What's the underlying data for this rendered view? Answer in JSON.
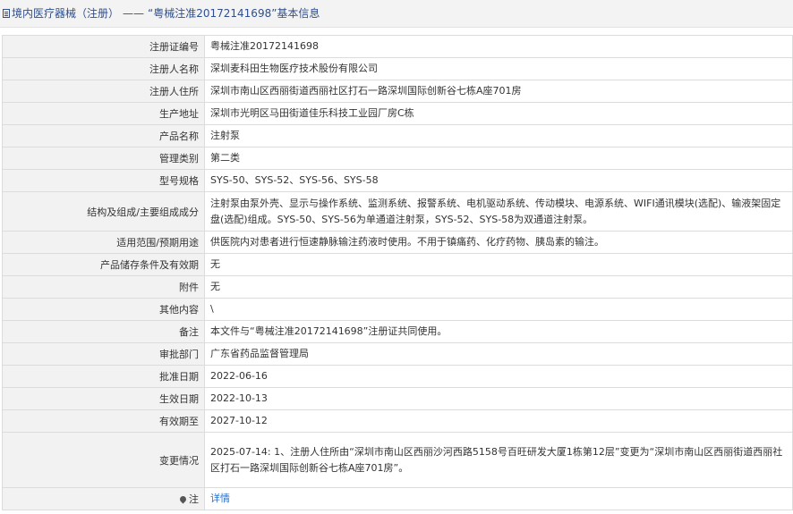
{
  "header": {
    "category": "境内医疗器械（注册）",
    "separator": "——",
    "title": "“粤械注准20172141698”基本信息"
  },
  "rows": [
    {
      "label": "注册证编号",
      "value": "粤械注准20172141698"
    },
    {
      "label": "注册人名称",
      "value": "深圳麦科田生物医疗技术股份有限公司"
    },
    {
      "label": "注册人住所",
      "value": "深圳市南山区西丽街道西丽社区打石一路深圳国际创新谷七栋A座701房"
    },
    {
      "label": "生产地址",
      "value": "深圳市光明区马田街道佳乐科技工业园厂房C栋"
    },
    {
      "label": "产品名称",
      "value": "注射泵"
    },
    {
      "label": "管理类别",
      "value": "第二类"
    },
    {
      "label": "型号规格",
      "value": "SYS-50、SYS-52、SYS-56、SYS-58"
    },
    {
      "label": "结构及组成/主要组成成分",
      "value": "注射泵由泵外壳、显示与操作系统、监测系统、报警系统、电机驱动系统、传动模块、电源系统、WIFI通讯模块(选配)、输液架固定盘(选配)组成。SYS-50、SYS-56为单通道注射泵，SYS-52、SYS-58为双通道注射泵。"
    },
    {
      "label": "适用范围/预期用途",
      "value": "供医院内对患者进行恒速静脉输注药液时使用。不用于镇痛药、化疗药物、胰岛素的输注。"
    },
    {
      "label": "产品储存条件及有效期",
      "value": "无"
    },
    {
      "label": "附件",
      "value": "无"
    },
    {
      "label": "其他内容",
      "value": "\\"
    },
    {
      "label": "备注",
      "value": "本文件与“粤械注准20172141698”注册证共同使用。"
    },
    {
      "label": "审批部门",
      "value": "广东省药品监督管理局"
    },
    {
      "label": "批准日期",
      "value": "2022-06-16"
    },
    {
      "label": "生效日期",
      "value": "2022-10-13"
    },
    {
      "label": "有效期至",
      "value": "2027-10-12"
    },
    {
      "label": "变更情况",
      "value": "2025-07-14: 1、注册人住所由“深圳市南山区西丽沙河西路5158号百旺研发大厦1栋第12层”变更为“深圳市南山区西丽街道西丽社区打石一路深圳国际创新谷七栋A座701房”。"
    }
  ],
  "note": {
    "label": "注",
    "icon": "pin-icon",
    "link_text": "详情"
  },
  "colors": {
    "header_text": "#2f4f8f",
    "label_bg": "#f2f2f2",
    "link": "#2a6fc9"
  }
}
